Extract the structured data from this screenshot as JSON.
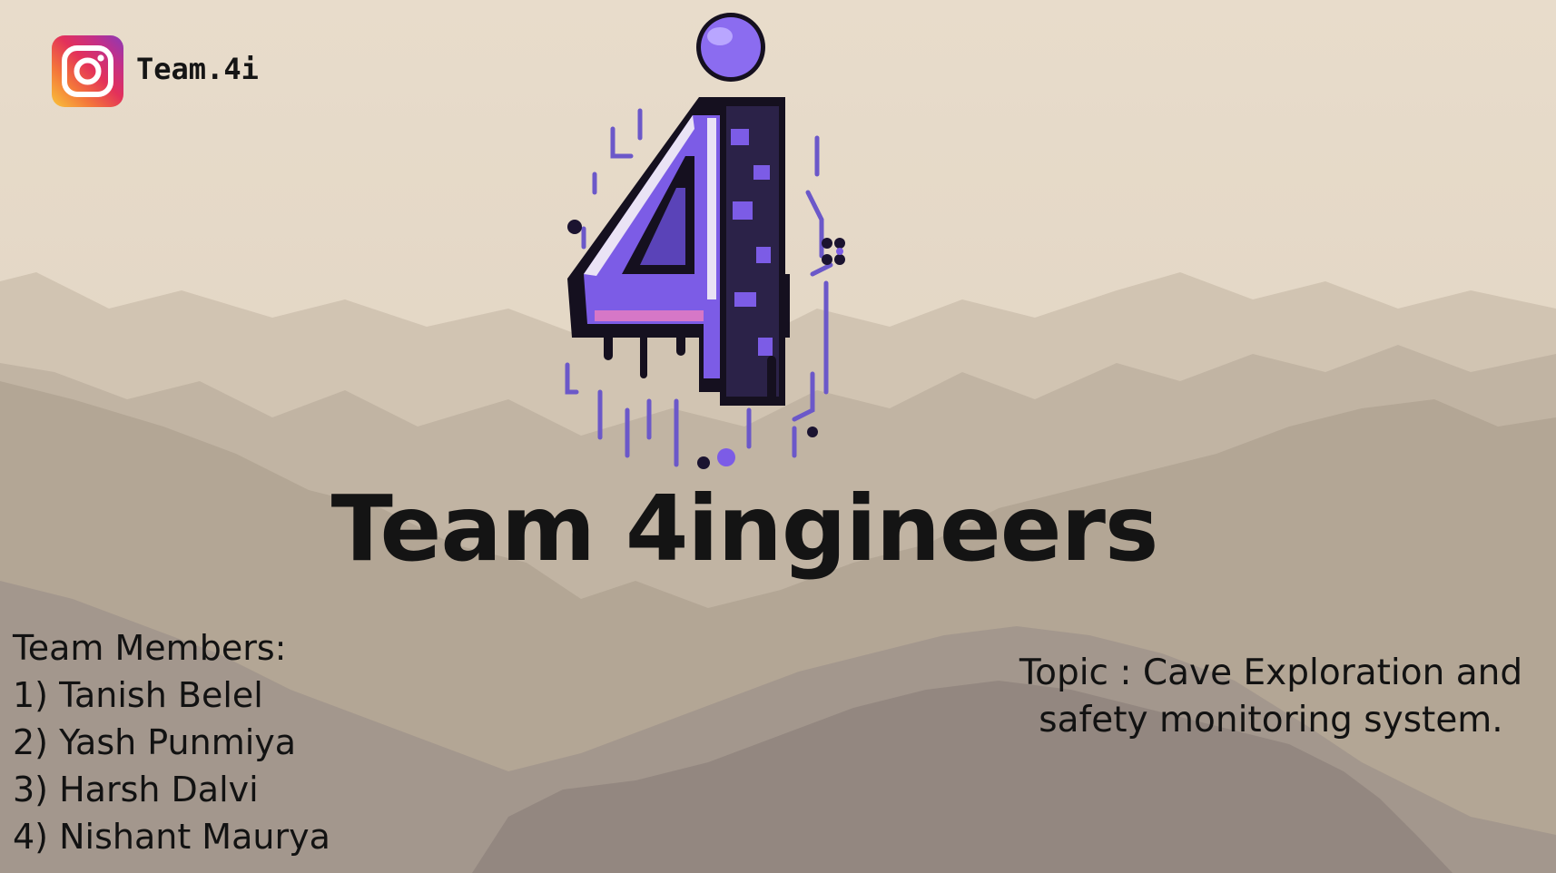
{
  "social": {
    "icon": "instagram-icon",
    "handle": "Team.4i"
  },
  "logo": {
    "icon": "team-4i-logo"
  },
  "title": "Team 4ingineers",
  "members": {
    "heading": "Team Members:",
    "items": [
      "1) Tanish Belel",
      "2) Yash Punmiya",
      "3) Harsh Dalvi",
      "4) Nishant Maurya"
    ]
  },
  "topic": {
    "line1": "Topic : Cave Exploration and",
    "line2": "safety monitoring system."
  },
  "colors": {
    "sky": "#e6d9c6",
    "mountain_far": "#c9bcaa",
    "mountain_mid": "#b5a898",
    "mountain_near": "#9c9088",
    "logo_purple": "#7c5ce6",
    "text": "#141414"
  }
}
